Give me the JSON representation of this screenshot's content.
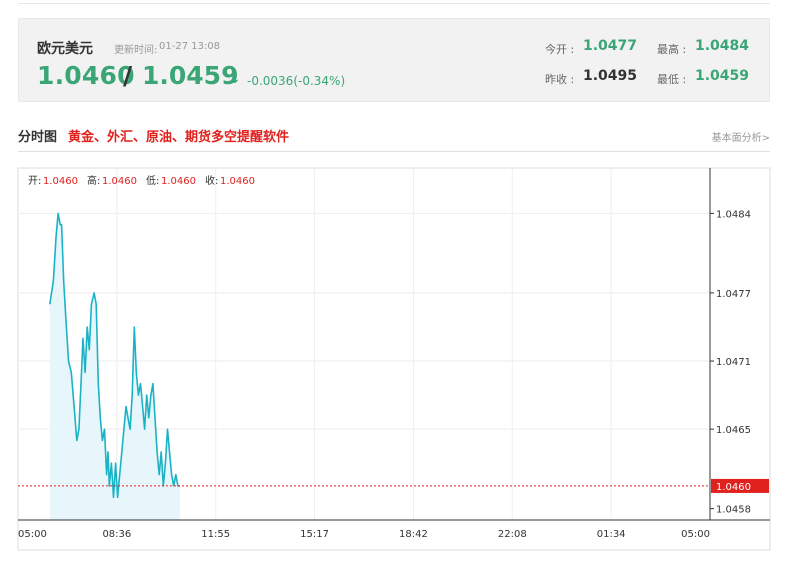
{
  "quote": {
    "name": "欧元美元",
    "update_label": "更新时间:",
    "update_time": "01-27 13:08",
    "bid": "1.0460",
    "slash": "/",
    "ask": "1.0459",
    "arrow": "↓",
    "change": "-0.0036(-0.34%)",
    "today_open_label": "今开 :",
    "today_open": "1.0477",
    "prev_close_label": "昨收 :",
    "prev_close": "1.0495",
    "high_label": "最高 :",
    "high": "1.0484",
    "low_label": "最低 :",
    "low": "1.0459"
  },
  "section": {
    "title": "分时图",
    "ad": "黄金、外汇、原油、期货多空提醒软件",
    "link": "基本面分析>"
  },
  "ohlc": {
    "open_label": "开:",
    "open": "1.0460",
    "high_label": "高:",
    "high": "1.0460",
    "low_label": "低:",
    "low": "1.0460",
    "close_label": "收:",
    "close": "1.0460"
  },
  "colors": {
    "line": "#1ab3c6",
    "area": "#e6f6fa",
    "green": "#3aa676",
    "red": "#e0211d"
  },
  "chart_data": {
    "type": "area",
    "x_ticks": [
      "05:00",
      "08:36",
      "11:55",
      "15:17",
      "18:42",
      "22:08",
      "01:34",
      "05:00"
    ],
    "y_ticks": [
      1.0484,
      1.0477,
      1.0471,
      1.0465,
      1.0458
    ],
    "ylim": [
      1.0457,
      1.0488
    ],
    "current": {
      "value": 1.046,
      "label": "1.0460"
    },
    "grid": true,
    "x_fraction": [
      0.046,
      0.051,
      0.055,
      0.058,
      0.061,
      0.063,
      0.066,
      0.069,
      0.073,
      0.077,
      0.081,
      0.085,
      0.088,
      0.091,
      0.094,
      0.097,
      0.1,
      0.103,
      0.106,
      0.11,
      0.113,
      0.116,
      0.119,
      0.122,
      0.125,
      0.128,
      0.13,
      0.132,
      0.135,
      0.138,
      0.141,
      0.144,
      0.147,
      0.15,
      0.153,
      0.156,
      0.159,
      0.162,
      0.165,
      0.168,
      0.171,
      0.174,
      0.177,
      0.18,
      0.183,
      0.186,
      0.189,
      0.192,
      0.195,
      0.198,
      0.201,
      0.204,
      0.207,
      0.21,
      0.213,
      0.216,
      0.219,
      0.222,
      0.225,
      0.228,
      0.231,
      0.234
    ],
    "values": [
      1.0476,
      1.0478,
      1.0482,
      1.0484,
      1.0483,
      1.0483,
      1.0478,
      1.0475,
      1.0471,
      1.047,
      1.0467,
      1.0464,
      1.0465,
      1.0469,
      1.0473,
      1.047,
      1.0474,
      1.0472,
      1.0476,
      1.0477,
      1.0476,
      1.0469,
      1.0466,
      1.0464,
      1.0465,
      1.0461,
      1.0463,
      1.046,
      1.0462,
      1.0459,
      1.0462,
      1.0459,
      1.0461,
      1.0463,
      1.0465,
      1.0467,
      1.0466,
      1.0465,
      1.0468,
      1.0474,
      1.047,
      1.0468,
      1.0469,
      1.0467,
      1.0465,
      1.0468,
      1.0466,
      1.0468,
      1.0469,
      1.0466,
      1.0463,
      1.0461,
      1.0463,
      1.046,
      1.0462,
      1.0465,
      1.0463,
      1.0461,
      1.046,
      1.0461,
      1.046,
      1.046
    ]
  }
}
